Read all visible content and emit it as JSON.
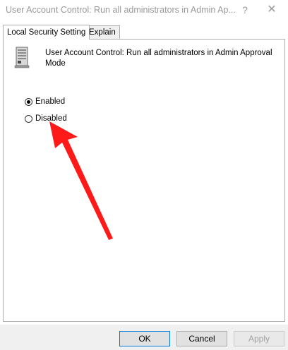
{
  "window": {
    "title": "User Account Control: Run all administrators in Admin Ap...",
    "help_glyph": "?",
    "close_glyph": "✕"
  },
  "tabs": [
    {
      "label": "Local Security Setting",
      "active": true
    },
    {
      "label": "Explain",
      "active": false
    }
  ],
  "policy": {
    "title": "User Account Control: Run all administrators in Admin Approval Mode",
    "icon": "server-policy-icon"
  },
  "options": [
    {
      "label": "Enabled",
      "selected": true
    },
    {
      "label": "Disabled",
      "selected": false
    }
  ],
  "annotation": {
    "color": "#ff0000",
    "icon": "red-arrow"
  },
  "buttons": {
    "ok": "OK",
    "cancel": "Cancel",
    "apply": "Apply"
  }
}
